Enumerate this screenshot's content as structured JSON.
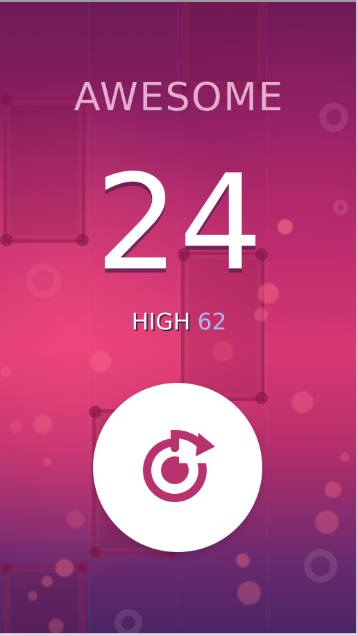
{
  "result": {
    "title": "AWESOME",
    "score": "24"
  },
  "high": {
    "label": "HIGH",
    "value": "62"
  },
  "replay": {
    "icon": "replay-icon"
  },
  "colors": {
    "background_top": "#6e1a57",
    "background_mid": "#d93a73",
    "background_bottom": "#4a2463",
    "high_value": "#a9b7f5",
    "icon_accent": "#b8336e"
  }
}
